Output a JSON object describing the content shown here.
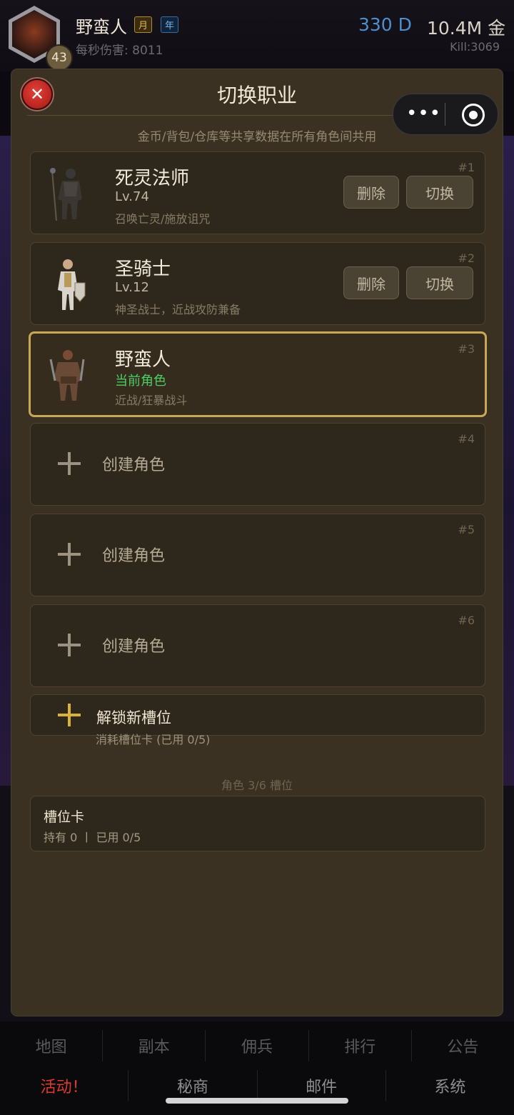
{
  "player": {
    "name": "野蛮人",
    "tag_month": "月",
    "tag_year": "年",
    "level": "43",
    "dps": "每秒伤害: 8011",
    "diamonds": "330 D",
    "gold": "10.4M 金",
    "kills": "Kill:3069"
  },
  "modal": {
    "title": "切换职业",
    "subtitle": "金币/背包/仓库等共享数据在所有角色间共用",
    "delete_label": "删除",
    "switch_label": "切换",
    "create_label": "创建角色",
    "characters": [
      {
        "slot": "#1",
        "name": "死灵法师",
        "level": "Lv.74",
        "desc": "召唤亡灵/施放诅咒"
      },
      {
        "slot": "#2",
        "name": "圣骑士",
        "level": "Lv.12",
        "desc": "神圣战士，近战攻防兼备"
      },
      {
        "slot": "#3",
        "name": "野蛮人",
        "status": "当前角色",
        "desc": "近战/狂暴战斗"
      }
    ],
    "empty_slots": [
      "#4",
      "#5",
      "#6"
    ],
    "unlock": {
      "title": "解锁新槽位",
      "subtitle": "消耗槽位卡 (已用 0/5)"
    },
    "slot_count": "角色 3/6 槽位",
    "slot_card": {
      "title": "槽位卡",
      "stat": "持有 0 丨 已用 0/5"
    }
  },
  "nav": {
    "row1": [
      "地图",
      "副本",
      "佣兵",
      "排行",
      "公告"
    ],
    "row2": [
      "活动！",
      "秘商",
      "邮件",
      "系统"
    ]
  }
}
